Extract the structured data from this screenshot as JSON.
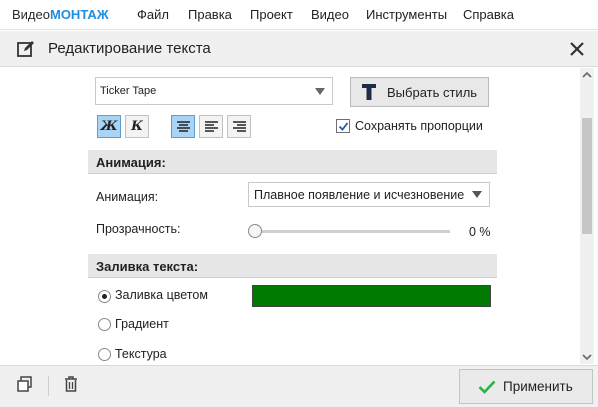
{
  "app": {
    "logo_prefix": "Видео",
    "logo_brand": "МОНТАЖ",
    "brand_color": "#1e8ee0"
  },
  "menu": [
    "Файл",
    "Правка",
    "Проект",
    "Видео",
    "Инструменты",
    "Справка"
  ],
  "panel": {
    "title": "Редактирование текста"
  },
  "font": {
    "selected": "Ticker Tape"
  },
  "style_button": {
    "label": "Выбрать стиль"
  },
  "keep_proportions": {
    "label": "Сохранять пропорции",
    "checked": true
  },
  "format_buttons": [
    {
      "glyph": "Ж",
      "name": "bold",
      "active": true
    },
    {
      "glyph": "К",
      "name": "italic",
      "active": false
    }
  ],
  "align_buttons": [
    {
      "name": "align-center",
      "active": true
    },
    {
      "name": "align-left",
      "active": false
    },
    {
      "name": "align-right",
      "active": false
    }
  ],
  "animation_section": {
    "header": "Анимация:",
    "animation_label": "Анимация:",
    "animation_value": "Плавное появление и исчезновение",
    "opacity_label": "Прозрачность:",
    "opacity_value": "0 %",
    "opacity_fraction": 0
  },
  "fill_section": {
    "header": "Заливка текста:",
    "options": [
      {
        "label": "Заливка цветом",
        "selected": true
      },
      {
        "label": "Градиент",
        "selected": false
      },
      {
        "label": "Текстура",
        "selected": false
      }
    ],
    "fill_color": "#007a00"
  },
  "footer": {
    "apply_label": "Применить",
    "apply_icon_color": "#2bb24c"
  }
}
